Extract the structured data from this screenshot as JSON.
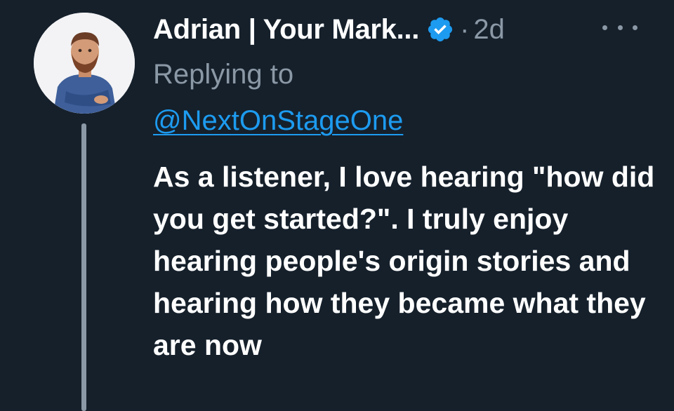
{
  "tweet": {
    "author_name": "Adrian | Your Mark...",
    "verified": true,
    "separator": "·",
    "timestamp": "2d",
    "replying_label": "Replying to",
    "replying_handle": "@NextOnStageOne",
    "text": "As a listener, I love hearing \"how did you get started?\". I truly enjoy hearing people's origin stories and hearing how they became what they are now"
  },
  "icons": {
    "avatar": "avatar-cartoon-man",
    "verified": "verified-badge-icon",
    "more": "more-options-icon"
  },
  "colors": {
    "background": "#15202b",
    "primary_text": "#ffffff",
    "secondary_text": "#8b98a5",
    "accent": "#1d9bf0"
  }
}
